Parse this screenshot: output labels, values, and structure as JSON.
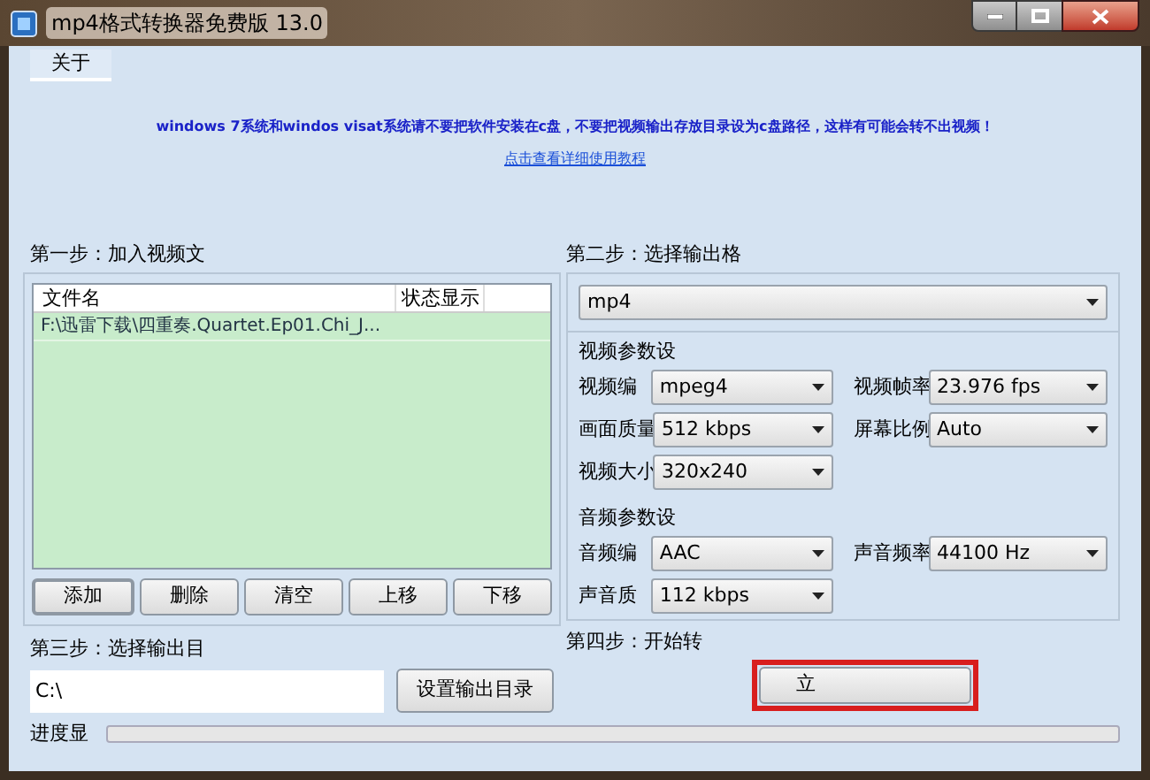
{
  "window": {
    "title": "mp4格式转换器免费版 13.0"
  },
  "menu": [
    {
      "label": "关于"
    }
  ],
  "notice": "windows 7系统和windos visat系统请不要把软件安装在c盘，不要把视频输出存放目录设为c盘路径，这样有可能会转不出视频！",
  "tutorial_link": "点击查看详细使用教程",
  "step1": {
    "label": "第一步：加入视频文",
    "columns": [
      "文件名",
      "状态显示"
    ],
    "rows": [
      {
        "file": "F:\\迅雷下载\\四重奏.Quartet.Ep01.Chi_J..."
      }
    ],
    "buttons": [
      {
        "label": "添加",
        "focused": true
      },
      {
        "label": "删除",
        "focused": false
      },
      {
        "label": "清空",
        "focused": false
      },
      {
        "label": "上移",
        "focused": false
      },
      {
        "label": "下移",
        "focused": false
      }
    ]
  },
  "step2": {
    "label": "第二步：选择输出格",
    "format": "mp4",
    "video_section": "视频参数设",
    "video_fields": [
      {
        "label": "视频编",
        "value": "mpeg4"
      },
      {
        "label": "视频帧率",
        "value": "23.976 fps"
      },
      {
        "label": "画面质量",
        "value": "512 kbps"
      },
      {
        "label": "屏幕比例",
        "value": "Auto"
      },
      {
        "label": "视频大小",
        "value": "320x240"
      }
    ],
    "audio_section": "音频参数设",
    "audio_fields": [
      {
        "label": "音频编",
        "value": "AAC"
      },
      {
        "label": "声音频率",
        "value": "44100 Hz"
      },
      {
        "label": "声音质",
        "value": "112 kbps"
      }
    ]
  },
  "step3": {
    "label": "第三步：选择输出目",
    "path": "C:\\",
    "button": "设置输出目录"
  },
  "step4": {
    "label": "第四步：开始转",
    "button": "立"
  },
  "progress": {
    "label": "进度显",
    "level": 0
  }
}
